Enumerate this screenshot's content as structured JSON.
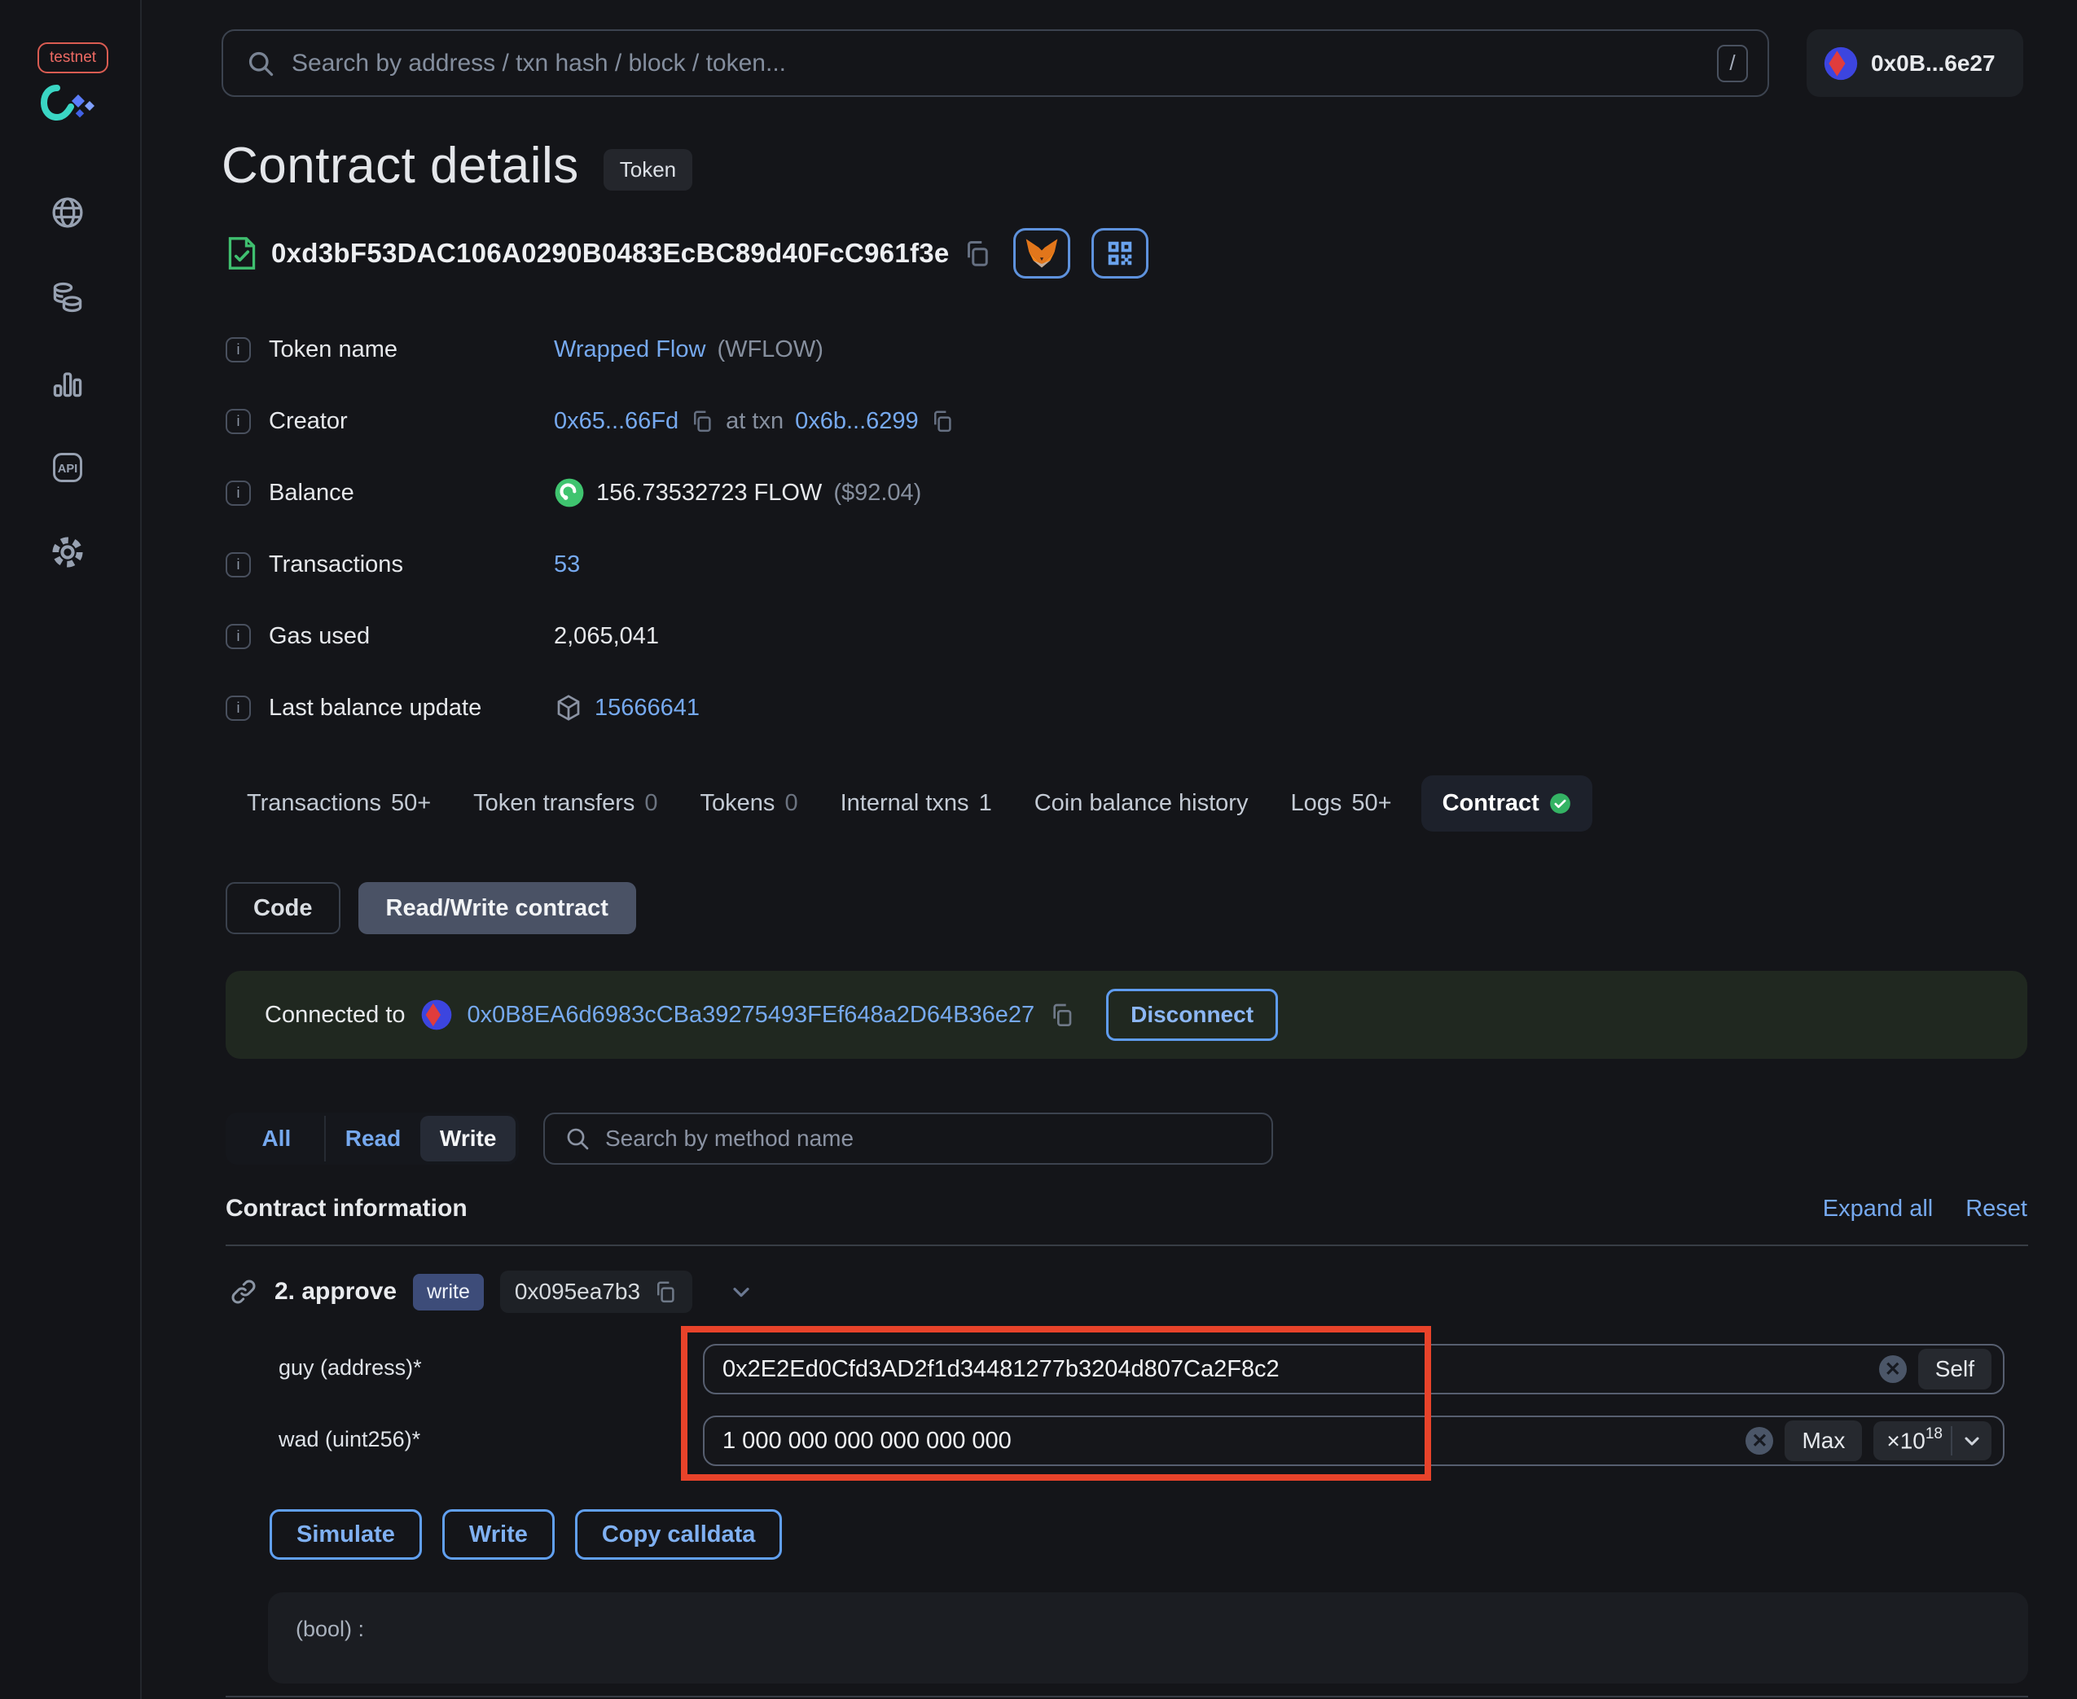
{
  "colors": {
    "accent_blue": "#76a9ef",
    "success_green": "#3fbf6f",
    "annotation_red": "#e8432a",
    "write_badge_blue": "#3d4c79"
  },
  "sidebar": {
    "network_badge": "testnet",
    "icons": [
      "globe-icon",
      "coins-icon",
      "stats-icon",
      "api-icon",
      "gear-icon"
    ]
  },
  "topbar": {
    "search_placeholder": "Search by address / txn hash / block / token...",
    "shortcut_key": "/",
    "account_label": "0x0B...6e27"
  },
  "page": {
    "title": "Contract details",
    "type_badge": "Token",
    "address": "0xd3bF53DAC106A0290B0483EcBC89d40FcC961f3e"
  },
  "info": {
    "token_name": {
      "label": "Token name",
      "link": "Wrapped Flow",
      "suffix": "(WFLOW)"
    },
    "creator": {
      "label": "Creator",
      "address": "0x65...66Fd",
      "mid": "at txn",
      "txn": "0x6b...6299"
    },
    "balance": {
      "label": "Balance",
      "value": "156.73532723 FLOW",
      "usd": "($92.04)"
    },
    "transactions": {
      "label": "Transactions",
      "value": "53"
    },
    "gas_used": {
      "label": "Gas used",
      "value": "2,065,041"
    },
    "last_balance_update": {
      "label": "Last balance update",
      "value": "15666641"
    }
  },
  "tabs": [
    {
      "label": "Transactions",
      "count": "50+"
    },
    {
      "label": "Token transfers",
      "count": "0"
    },
    {
      "label": "Tokens",
      "count": "0"
    },
    {
      "label": "Internal txns",
      "count": "1"
    },
    {
      "label": "Coin balance history",
      "count": ""
    },
    {
      "label": "Logs",
      "count": "50+"
    },
    {
      "label": "Contract",
      "count": ""
    }
  ],
  "contract_tabs": {
    "code": "Code",
    "read_write": "Read/Write contract"
  },
  "connection": {
    "prefix": "Connected to",
    "address": "0x0B8EA6d6983cCBa39275493FEf648a2D64B36e27",
    "disconnect_label": "Disconnect"
  },
  "method_filter": {
    "all": "All",
    "read": "Read",
    "write": "Write",
    "search_placeholder": "Search by method name"
  },
  "contract_info": {
    "heading": "Contract information",
    "expand_all": "Expand all",
    "reset": "Reset"
  },
  "method": {
    "index_name": "2. approve",
    "badge": "write",
    "selector": "0x095ea7b3",
    "fields": {
      "guy": {
        "label": "guy (address)*",
        "value": "0x2E2Ed0Cfd3AD2f1d34481277b3204d807Ca2F8c2",
        "action": "Self"
      },
      "wad": {
        "label": "wad (uint256)*",
        "value": "1 000 000 000 000 000 000",
        "action": "Max",
        "multiplier_base": "×10",
        "multiplier_exp": "18"
      }
    },
    "actions": {
      "simulate": "Simulate",
      "write": "Write",
      "copy_calldata": "Copy calldata"
    },
    "output": "(bool) :"
  }
}
